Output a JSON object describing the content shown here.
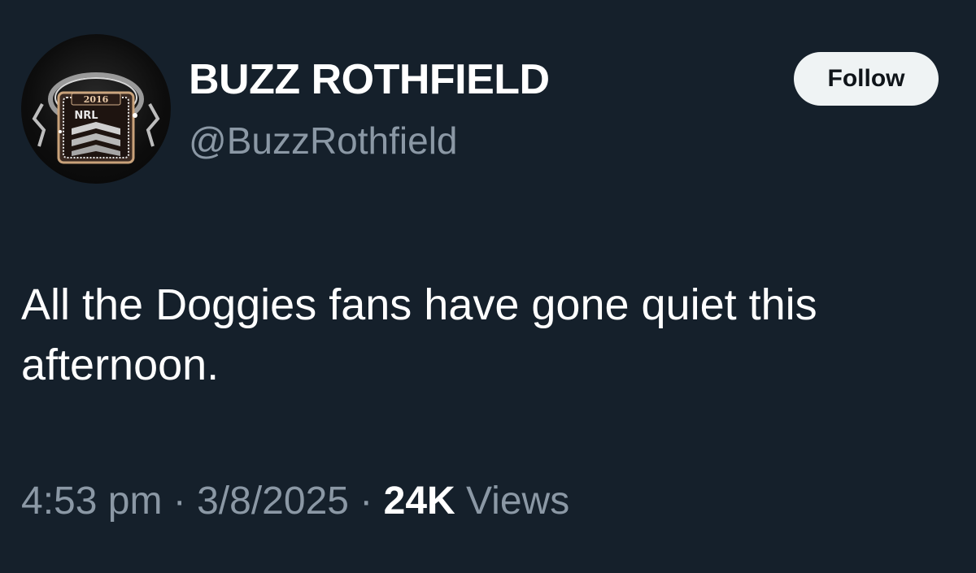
{
  "author": {
    "display_name": "BUZZ ROTHFIELD",
    "handle": "@BuzzRothfield",
    "avatar": {
      "icon": "nrl-premiership-ring",
      "ring_year": "2016",
      "ring_label": "NRL"
    }
  },
  "follow_button": {
    "label": "Follow"
  },
  "tweet": {
    "text": "All the Doggies fans have gone quiet this afternoon."
  },
  "meta": {
    "time": "4:53 pm",
    "separator": "·",
    "date": "3/8/2025",
    "views_count": "24K",
    "views_label": "Views"
  },
  "colors": {
    "background": "#15202b",
    "primary_text": "#ffffff",
    "secondary_text": "#8b98a5",
    "button_bg": "#eff3f4",
    "button_text": "#0f1419"
  }
}
